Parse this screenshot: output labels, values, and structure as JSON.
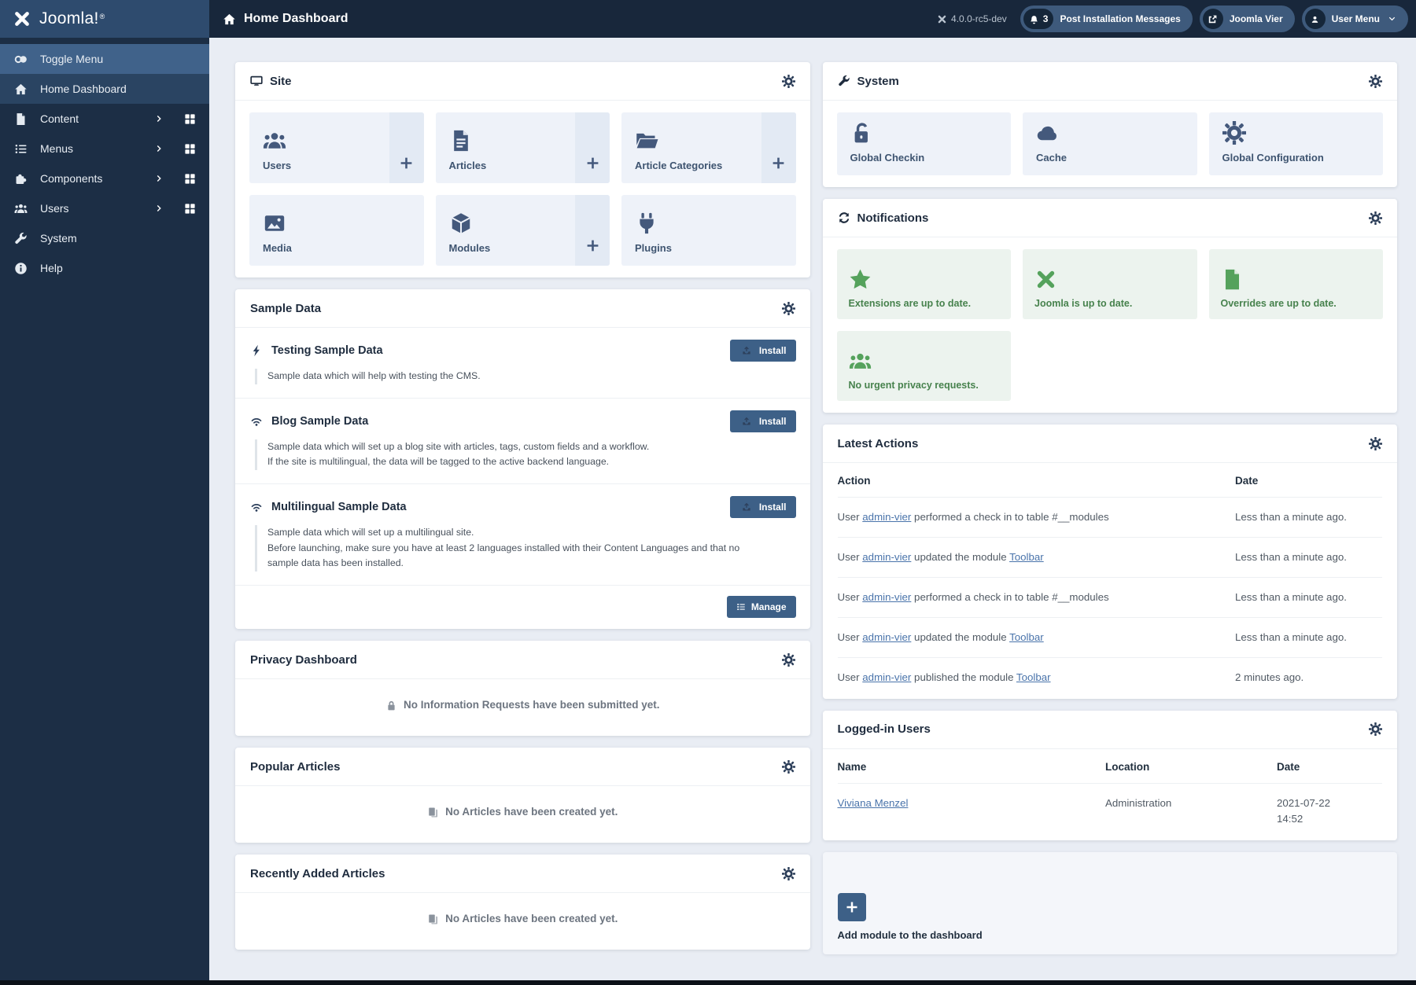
{
  "topbar": {
    "logo": "Joomla!",
    "logo_mark": "®",
    "title": "Home Dashboard",
    "version": "4.0.0-rc5-dev",
    "messages_count": "3",
    "messages_label": "Post Installation Messages",
    "site_name": "Joomla Vier",
    "user_menu": "User Menu"
  },
  "sidebar": {
    "items": [
      {
        "label": "Toggle Menu"
      },
      {
        "label": "Home Dashboard"
      },
      {
        "label": "Content"
      },
      {
        "label": "Menus"
      },
      {
        "label": "Components"
      },
      {
        "label": "Users"
      },
      {
        "label": "System"
      },
      {
        "label": "Help"
      }
    ]
  },
  "site": {
    "title": "Site",
    "tiles": [
      {
        "label": "Users"
      },
      {
        "label": "Articles"
      },
      {
        "label": "Article Categories"
      },
      {
        "label": "Media"
      },
      {
        "label": "Modules"
      },
      {
        "label": "Plugins"
      }
    ]
  },
  "sample_data": {
    "title": "Sample Data",
    "manage": "Manage",
    "items": [
      {
        "title": "Testing Sample Data",
        "button": "Install",
        "desc1": "Sample data which will help with testing the CMS.",
        "desc2": ""
      },
      {
        "title": "Blog Sample Data",
        "button": "Install",
        "desc1": "Sample data which will set up a blog site with articles, tags, custom fields and a workflow.",
        "desc2": "If the site is multilingual, the data will be tagged to the active backend language."
      },
      {
        "title": "Multilingual Sample Data",
        "button": "Install",
        "desc1": "Sample data which will set up a multilingual site.",
        "desc2": "Before launching, make sure you have at least 2 languages installed with their Content Languages and that no sample data has been installed."
      }
    ]
  },
  "privacy_dashboard": {
    "title": "Privacy Dashboard",
    "empty": "No Information Requests have been submitted yet."
  },
  "popular_articles": {
    "title": "Popular Articles",
    "empty": "No Articles have been created yet."
  },
  "recent_articles": {
    "title": "Recently Added Articles",
    "empty": "No Articles have been created yet."
  },
  "system": {
    "title": "System",
    "tiles": [
      {
        "label": "Global Checkin"
      },
      {
        "label": "Cache"
      },
      {
        "label": "Global Configuration"
      }
    ]
  },
  "notifications": {
    "title": "Notifications",
    "tiles": [
      {
        "label": "Extensions are up to date."
      },
      {
        "label": "Joomla is up to date."
      },
      {
        "label": "Overrides are up to date."
      },
      {
        "label": "No urgent privacy requests."
      }
    ]
  },
  "latest_actions": {
    "title": "Latest Actions",
    "col_action": "Action",
    "col_date": "Date",
    "rows": [
      {
        "prefix": "User ",
        "user": "admin-vier",
        "text": " performed a check in to table #__modules",
        "module": "",
        "date": "Less than a minute ago."
      },
      {
        "prefix": "User ",
        "user": "admin-vier",
        "text": " updated the module ",
        "module": "Toolbar",
        "date": "Less than a minute ago."
      },
      {
        "prefix": "User ",
        "user": "admin-vier",
        "text": " performed a check in to table #__modules",
        "module": "",
        "date": "Less than a minute ago."
      },
      {
        "prefix": "User ",
        "user": "admin-vier",
        "text": " updated the module ",
        "module": "Toolbar",
        "date": "Less than a minute ago."
      },
      {
        "prefix": "User ",
        "user": "admin-vier",
        "text": " published the module ",
        "module": "Toolbar",
        "date": "2 minutes ago."
      }
    ]
  },
  "logged_in_users": {
    "title": "Logged-in Users",
    "col_name": "Name",
    "col_location": "Location",
    "col_date": "Date",
    "rows": [
      {
        "name": "Viviana Menzel",
        "location": "Administration",
        "date1": "2021-07-22",
        "date2": "14:52"
      }
    ]
  },
  "add_module": {
    "label": "Add module to the dashboard"
  }
}
